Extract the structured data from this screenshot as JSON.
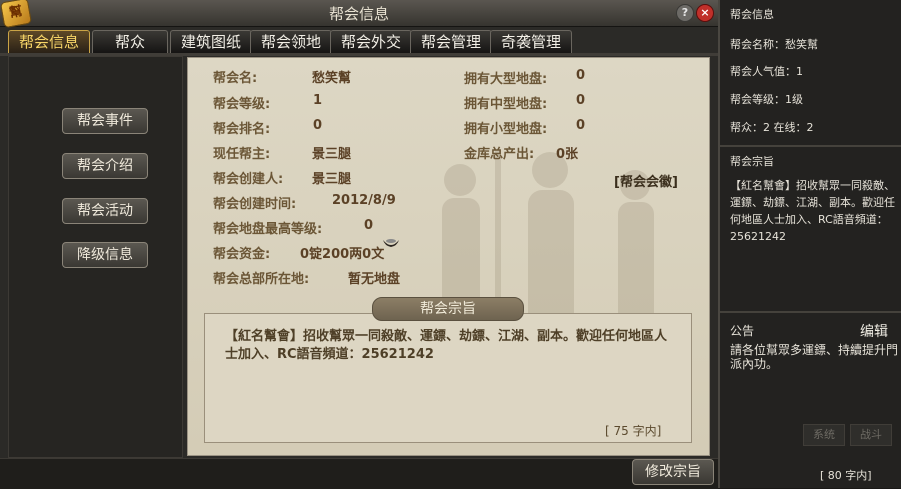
{
  "window": {
    "title": "帮会信息",
    "logo_glyph": "幫",
    "help_glyph": "?",
    "close_glyph": "×"
  },
  "tabs": [
    {
      "label": "帮会信息",
      "active": true
    },
    {
      "label": "帮众",
      "active": false
    },
    {
      "label": "建筑图纸",
      "active": false
    },
    {
      "label": "帮会领地",
      "active": false
    },
    {
      "label": "帮会外交",
      "active": false
    },
    {
      "label": "帮会管理",
      "active": false
    },
    {
      "label": "奇袭管理",
      "active": false
    }
  ],
  "sidebar": {
    "buttons": [
      "帮会事件",
      "帮会介绍",
      "帮会活动",
      "降级信息"
    ]
  },
  "info": {
    "name_label": "帮会名:",
    "name": "愁笑幫",
    "level_label": "帮会等级:",
    "level": "1",
    "rank_label": "帮会排名:",
    "rank": "0",
    "leader_label": "现任帮主:",
    "leader": "景三腿",
    "founder_label": "帮会创建人:",
    "founder": "景三腿",
    "created_label": "帮会创建时间:",
    "created": "2012/8/9",
    "max_level_label": "帮会地盘最高等级:",
    "max_level": "0",
    "funds_label": "帮会资金:",
    "funds": "0锭200两0文",
    "hq_label": "帮会总部所在地:",
    "hq": "暂无地盘",
    "large_label": "拥有大型地盘:",
    "large": "0",
    "medium_label": "拥有中型地盘:",
    "medium": "0",
    "small_label": "拥有小型地盘:",
    "small": "0",
    "treasury_label": "金库总产出:",
    "treasury": "0张",
    "emblem_link": "[帮会会徽]"
  },
  "motto": {
    "banner": "帮会宗旨",
    "text": "【紅名幫會】招收幫眾一同殺敵、運鏢、劫鏢、江湖、副本。歡迎任何地區人士加入、RC語音頻道：25621242",
    "count_bracket_open": "[",
    "count": "75",
    "count_unit": "字内]"
  },
  "bottom": {
    "modify_button": "修改宗旨"
  },
  "right_panel": {
    "info_header": "帮会信息",
    "name_line": "帮会名称：愁笑幫",
    "popularity_line": "帮会人气值：1",
    "level_line": "帮会等级：1级",
    "members_line": "帮众：2 在线：2",
    "motto_header": "帮会宗旨",
    "motto_text": "【紅名幫會】招收幫眾一同殺敵、運鏢、劫鏢、江湖、副本。歡迎任何地區人士加入、RC語音頻道：25621242",
    "notice_header": "公告",
    "edit_label": "编辑",
    "notice_text": "請各位幫眾多運鏢、持續提升門派內功。",
    "btn_system": "系统",
    "btn_battle": "战斗",
    "count_text": "[ 80 字内]"
  },
  "colors": {
    "parchment": "#d9d2be",
    "active_tab_text": "#f7d568",
    "close_button": "#c0302a"
  }
}
